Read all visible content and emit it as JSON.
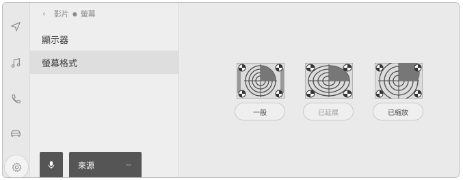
{
  "rail": {
    "icons": [
      "navigation-icon",
      "music-icon",
      "phone-icon",
      "car-icon",
      "settings-icon"
    ]
  },
  "breadcrumb": {
    "back_icon": "chevron-left-icon",
    "parent": "影片",
    "current": "螢幕"
  },
  "menu": {
    "items": [
      {
        "label": "顯示器",
        "selected": false
      },
      {
        "label": "螢幕格式",
        "selected": true
      }
    ]
  },
  "bottom": {
    "mic_icon": "microphone-icon",
    "source_label": "來源"
  },
  "formats": [
    {
      "label": "一般",
      "enabled": true
    },
    {
      "label": "已延展",
      "enabled": false
    },
    {
      "label": "已縮放",
      "enabled": true
    }
  ],
  "colors": {
    "selected_item": "#dedede",
    "dark_button": "#555555",
    "background": "#ededed"
  }
}
